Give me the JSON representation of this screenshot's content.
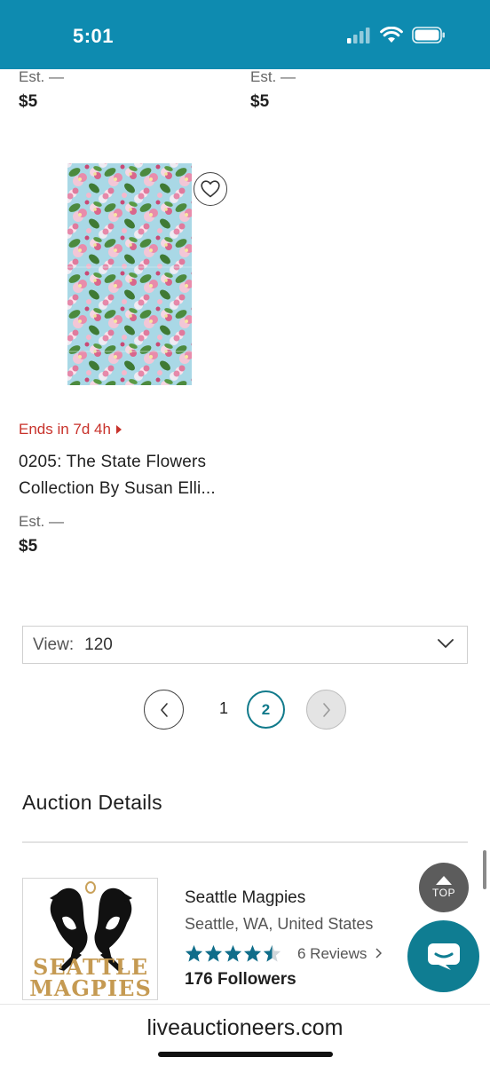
{
  "status_bar": {
    "time": "5:01",
    "accent_color": "#0e8bb0",
    "icons": [
      "cellular-signal-icon",
      "wifi-icon",
      "battery-icon"
    ]
  },
  "prev_items": [
    {
      "est": "Est. —",
      "price": "$5"
    },
    {
      "est": "Est. —",
      "price": "$5"
    }
  ],
  "lot": {
    "image": "floral-fabric-image",
    "favorite_icon": "heart-icon",
    "ends": "Ends in 7d 4h",
    "title": "0205: The State Flowers Collection By Susan Elli...",
    "est": "Est. —",
    "price": "$5",
    "ends_color": "#c8322b"
  },
  "view": {
    "label": "View:",
    "value": "120"
  },
  "pagination": {
    "pages": [
      "1",
      "2"
    ],
    "current": "2"
  },
  "auction_details": {
    "title": "Auction Details",
    "seller": {
      "logo_text_line1": "SEATTLE",
      "logo_text_line2": "MAGPIES",
      "name": "Seattle Magpies",
      "location": "Seattle, WA, United States",
      "rating": 4.5,
      "reviews": "6 Reviews",
      "followers": "176 Followers"
    }
  },
  "top_button": {
    "label": "TOP"
  },
  "browser": {
    "url": "liveauctioneers.com"
  },
  "colors": {
    "brand_teal": "#0f7d92",
    "current_page": "#117a8b"
  }
}
